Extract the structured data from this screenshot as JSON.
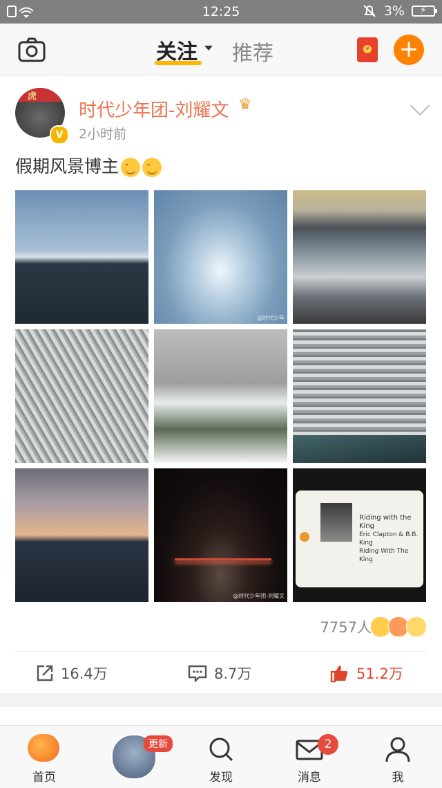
{
  "status_bar": {
    "time": "12:25",
    "battery": "3%"
  },
  "top_nav": {
    "tab_follow": "关注",
    "tab_recommend": "推荐",
    "accent_color": "#ffb400",
    "plus_color": "#ff8200"
  },
  "post": {
    "author": "时代少年团-刘耀文",
    "time": "2小时前",
    "text": "假期风景博主",
    "photo_watermarks": [
      "@时代少年",
      "@时代少年团-刘耀文",
      "@时代少年团-刘耀文"
    ],
    "music_card": {
      "title": "Riding with the King",
      "artist": "Eric Clapton & B.B. King",
      "album": "Riding With The King"
    },
    "reaction_count": "7757人",
    "actions": {
      "repost": "16.4万",
      "comment": "8.7万",
      "like": "51.2万"
    },
    "name_color": "#eb7350",
    "like_color": "#e0462c"
  },
  "bottom_nav": {
    "home": "首页",
    "story_tag": "更新",
    "discover": "发现",
    "messages": "消息",
    "messages_badge": "2",
    "me": "我"
  }
}
